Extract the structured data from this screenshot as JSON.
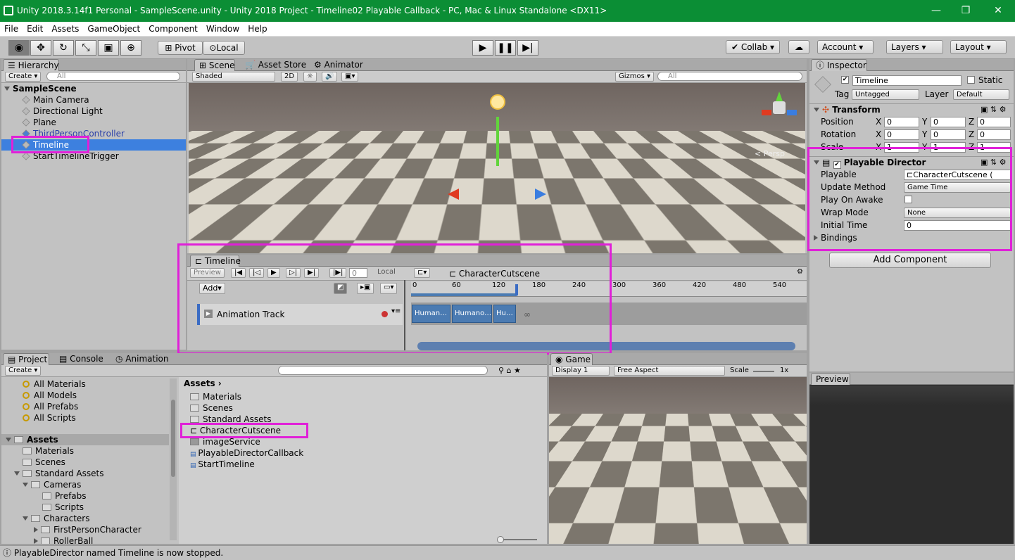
{
  "window": {
    "title": "Unity 2018.3.14f1 Personal - SampleScene.unity - Unity 2018 Project - Timeline02 Playable Callback - PC, Mac & Linux Standalone <DX11>",
    "minimize": "—",
    "maximize": "❐",
    "close": "✕"
  },
  "menu": [
    "File",
    "Edit",
    "Assets",
    "GameObject",
    "Component",
    "Window",
    "Help"
  ],
  "toolbar": {
    "pivot": "Pivot",
    "local": "Local",
    "collab": "Collab ▾",
    "account": "Account",
    "layers": "Layers",
    "layout": "Layout"
  },
  "hierarchy": {
    "tab": "Hierarchy",
    "create": "Create ▾",
    "search_placeholder": "All",
    "scene": "SampleScene",
    "items": [
      "Main Camera",
      "Directional Light",
      "Plane",
      "ThirdPersonController",
      "Timeline",
      "StartTimelineTrigger"
    ]
  },
  "scene_view": {
    "tabs": [
      "Scene",
      "Asset Store",
      "Animator"
    ],
    "shading": "Shaded",
    "mode2d": "2D",
    "gizmos": "Gizmos ▾",
    "search_placeholder": "All",
    "persp": "< Persp"
  },
  "timeline": {
    "tab": "Timeline",
    "preview": "Preview",
    "frame": "0",
    "local": "Local",
    "asset": "CharacterCutscene",
    "add": "Add▾",
    "track": "Animation Track",
    "ticks": [
      "0",
      "60",
      "120",
      "180",
      "240",
      "300",
      "360",
      "420",
      "480",
      "540"
    ],
    "clips": [
      "Human…",
      "Humano…",
      "Hu…"
    ]
  },
  "inspector": {
    "tab": "Inspector",
    "name": "Timeline",
    "static": "Static",
    "tag_label": "Tag",
    "tag": "Untagged",
    "layer_label": "Layer",
    "layer": "Default",
    "transform": {
      "title": "Transform",
      "position": "Position",
      "rotation": "Rotation",
      "scale": "Scale",
      "x": "X",
      "y": "Y",
      "z": "Z",
      "pos": [
        "0",
        "0",
        "0"
      ],
      "rot": [
        "0",
        "0",
        "0"
      ],
      "scl": [
        "1",
        "1",
        "1"
      ]
    },
    "director": {
      "title": "Playable Director",
      "playable_label": "Playable",
      "playable": "CharacterCutscene (",
      "update_label": "Update Method",
      "update": "Game Time",
      "awake_label": "Play On Awake",
      "wrap_label": "Wrap Mode",
      "wrap": "None",
      "initial_label": "Initial Time",
      "initial": "0",
      "bindings": "Bindings"
    },
    "add_component": "Add Component"
  },
  "project": {
    "tabs": [
      "Project",
      "Console",
      "Animation"
    ],
    "create": "Create ▾",
    "favorites": [
      "All Materials",
      "All Models",
      "All Prefabs",
      "All Scripts"
    ],
    "tree": [
      "Assets",
      "Materials",
      "Scenes",
      "Standard Assets",
      "Cameras",
      "Prefabs",
      "Scripts",
      "Characters",
      "FirstPersonCharacter",
      "RollerBall"
    ],
    "breadcrumb": "Assets",
    "assets": [
      "Materials",
      "Scenes",
      "Standard Assets",
      "CharacterCutscene",
      "imageService",
      "PlayableDirectorCallback",
      "StartTimeline"
    ]
  },
  "game": {
    "tab": "Game",
    "display": "Display 1",
    "aspect": "Free Aspect",
    "scale_label": "Scale",
    "scale": "1x"
  },
  "preview": {
    "tab": "Preview"
  },
  "status": "PlayableDirector named Timeline is now stopped."
}
